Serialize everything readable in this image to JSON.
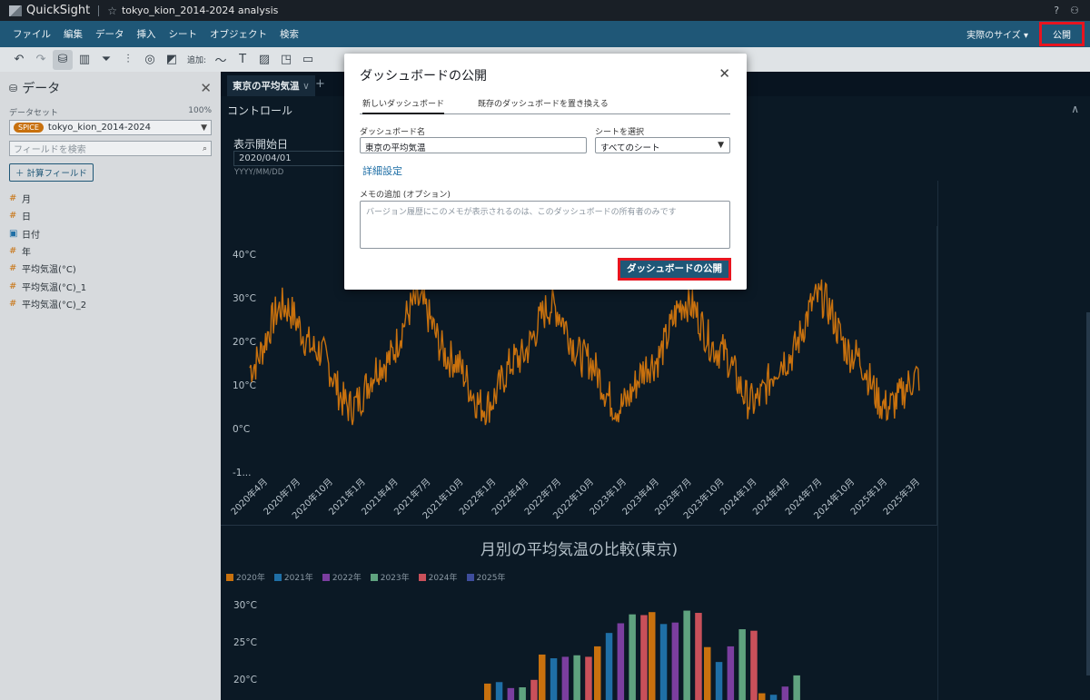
{
  "titlebar": {
    "app_name": "QuickSight",
    "analysis_title": "tokyo_kion_2014-2024 analysis"
  },
  "menubar": {
    "items": [
      "ファイル",
      "編集",
      "データ",
      "挿入",
      "シート",
      "オブジェクト",
      "検索"
    ],
    "size_label": "実際のサイズ",
    "publish_label": "公開"
  },
  "toolbar": {
    "add_label": "追加:"
  },
  "data_panel": {
    "title": "データ",
    "dataset_label": "データセット",
    "dataset_pct": "100%",
    "spice_badge": "SPICE",
    "dataset_name": "tokyo_kion_2014-2024",
    "field_search_placeholder": "フィールドを検索",
    "calc_field_label": "＋ 計算フィールド",
    "fields": [
      "月",
      "日",
      "日付",
      "年",
      "平均気温(°C)",
      "平均気温(°C)_1",
      "平均気温(°C)_2"
    ]
  },
  "canvas": {
    "sheet_tab": "東京の平均気温",
    "controls_title": "コントロール",
    "start_date_label": "表示開始日",
    "start_date_value": "2020/04/01",
    "start_date_format": "YYYY/MM/DD"
  },
  "bar_chart_title": "月別の平均気温の比較(東京)",
  "modal": {
    "title": "ダッシュボードの公開",
    "tab_new": "新しいダッシュボード",
    "tab_replace": "既存のダッシュボードを置き換える",
    "name_label": "ダッシュボード名",
    "name_value": "東京の平均気温",
    "sheet_label": "シートを選択",
    "sheet_value": "すべてのシート",
    "advanced_link": "詳細設定",
    "memo_label": "メモの追加 (オプション)",
    "memo_placeholder": "バージョン履歴にこのメモが表示されるのは、このダッシュボードの所有者のみです",
    "publish_button": "ダッシュボードの公開"
  },
  "colors": {
    "menu_bg": "#1f5777",
    "line": "#c8710e",
    "highlight": "#e8141f"
  },
  "chart_data": [
    {
      "type": "line",
      "title": "",
      "x": [
        "2020年4月",
        "2020年7月",
        "2020年10月",
        "2021年1月",
        "2021年4月",
        "2021年7月",
        "2021年10月",
        "2022年1月",
        "2022年4月",
        "2022年7月",
        "2022年10月",
        "2023年1月",
        "2023年4月",
        "2023年7月",
        "2023年10月",
        "2024年1月",
        "2024年4月",
        "2024年7月",
        "2024年10月",
        "2025年1月",
        "2025年3月"
      ],
      "series": [
        {
          "values": [
            14,
            28,
            18,
            5,
            15,
            29,
            16,
            5,
            16,
            28,
            16,
            5,
            15,
            29,
            18,
            6,
            16,
            30,
            17,
            5,
            12
          ]
        }
      ],
      "y_ticks": [
        "40°C",
        "30°C",
        "20°C",
        "10°C",
        "0°C",
        "-1..."
      ],
      "ylim": [
        -10,
        40
      ]
    },
    {
      "type": "bar",
      "title": "月別の平均気温の比較(東京)",
      "series": [
        {
          "name": "2020年",
          "color": "#c8710e"
        },
        {
          "name": "2021年",
          "color": "#1f6fa6"
        },
        {
          "name": "2022年",
          "color": "#7b3e9f"
        },
        {
          "name": "2023年",
          "color": "#5fa37f"
        },
        {
          "name": "2024年",
          "color": "#c9505a"
        },
        {
          "name": "2025年",
          "color": "#3e4d9c"
        }
      ],
      "y_ticks": [
        "30°C",
        "25°C",
        "20°C"
      ],
      "groups": [
        {
          "values": [
            19.4,
            19.6,
            18.8,
            18.9,
            19.9
          ]
        },
        {
          "values": [
            23.3,
            22.8,
            23.0,
            23.2,
            23.0
          ]
        },
        {
          "values": [
            24.4,
            26.2,
            27.5,
            28.7,
            28.6
          ]
        },
        {
          "values": [
            29.0,
            27.4,
            27.6,
            29.2,
            28.9
          ]
        },
        {
          "values": [
            24.3,
            22.3,
            24.4,
            26.7,
            26.5
          ]
        },
        {
          "values": [
            18.1,
            17.9,
            19.0,
            20.5
          ]
        }
      ]
    }
  ]
}
